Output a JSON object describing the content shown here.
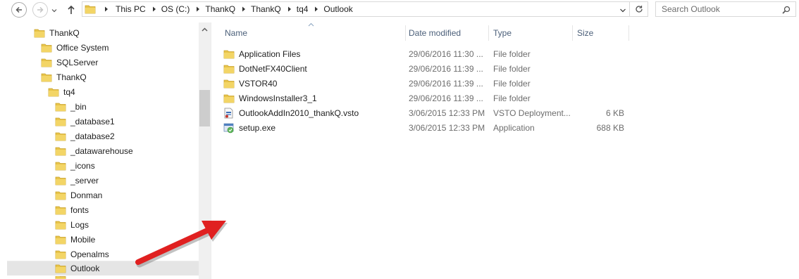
{
  "address_bar": {
    "breadcrumbs": [
      "This PC",
      "OS (C:)",
      "ThankQ",
      "ThankQ",
      "tq4",
      "Outlook"
    ],
    "search_placeholder": "Search Outlook"
  },
  "nav_pane": {
    "items": [
      {
        "label": "ThankQ",
        "selected": false
      },
      {
        "label": "Office System",
        "selected": false
      },
      {
        "label": "SQLServer",
        "selected": false
      },
      {
        "label": "ThankQ",
        "selected": false
      },
      {
        "label": "tq4",
        "selected": false
      },
      {
        "label": "_bin",
        "selected": false
      },
      {
        "label": "_database1",
        "selected": false
      },
      {
        "label": "_database2",
        "selected": false
      },
      {
        "label": "_datawarehouse",
        "selected": false
      },
      {
        "label": "_icons",
        "selected": false
      },
      {
        "label": "_server",
        "selected": false
      },
      {
        "label": "Donman",
        "selected": false
      },
      {
        "label": "fonts",
        "selected": false
      },
      {
        "label": "Logs",
        "selected": false
      },
      {
        "label": "Mobile",
        "selected": false
      },
      {
        "label": "Openalms",
        "selected": false
      },
      {
        "label": "Outlook",
        "selected": true
      }
    ]
  },
  "file_list": {
    "columns": {
      "name": "Name",
      "date": "Date modified",
      "type": "Type",
      "size": "Size"
    },
    "rows": [
      {
        "icon": "folder-icon",
        "name": "Application Files",
        "date": "29/06/2016 11:30 ...",
        "type": "File folder",
        "size": ""
      },
      {
        "icon": "folder-icon",
        "name": "DotNetFX40Client",
        "date": "29/06/2016 11:39 ...",
        "type": "File folder",
        "size": ""
      },
      {
        "icon": "folder-icon",
        "name": "VSTOR40",
        "date": "29/06/2016 11:39 ...",
        "type": "File folder",
        "size": ""
      },
      {
        "icon": "folder-icon",
        "name": "WindowsInstaller3_1",
        "date": "29/06/2016 11:39 ...",
        "type": "File folder",
        "size": ""
      },
      {
        "icon": "vsto-file-icon",
        "name": "OutlookAddIn2010_thankQ.vsto",
        "date": "3/06/2015 12:33 PM",
        "type": "VSTO Deployment...",
        "size": "6 KB"
      },
      {
        "icon": "setup-exe-icon",
        "name": "setup.exe",
        "date": "3/06/2015 12:33 PM",
        "type": "Application",
        "size": "688 KB"
      }
    ]
  },
  "colors": {
    "folder": "#e8c44a",
    "header_text": "#4c607a",
    "selected_bg": "#e5e5e5",
    "arrow": "#e02020"
  }
}
